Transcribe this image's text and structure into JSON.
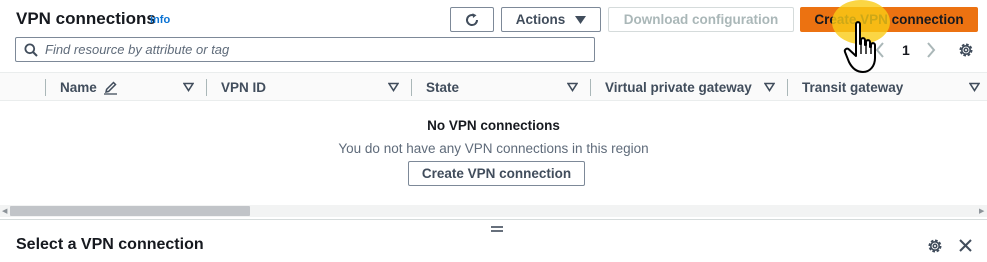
{
  "header": {
    "title": "VPN connections",
    "info_link": "info",
    "actions_label": "Actions",
    "download_label": "Download configuration",
    "create_label": "Create VPN connection"
  },
  "search": {
    "placeholder": "Find resource by attribute or tag",
    "value": ""
  },
  "pagination": {
    "current_page": "1"
  },
  "table": {
    "columns": [
      {
        "label": "Name",
        "editable": true
      },
      {
        "label": "VPN ID"
      },
      {
        "label": "State"
      },
      {
        "label": "Virtual private gateway"
      },
      {
        "label": "Transit gateway"
      }
    ],
    "rows": []
  },
  "empty_state": {
    "title": "No VPN connections",
    "message": "You do not have any VPN connections in this region",
    "button_label": "Create VPN connection"
  },
  "detail_panel": {
    "title": "Select a VPN connection"
  },
  "icons": {
    "refresh": "refresh-icon",
    "caret": "caret-down-icon",
    "search": "search-icon",
    "settings": "gear-icon",
    "close": "close-icon",
    "edit": "pencil-icon",
    "pointer": "hand-pointer-icon"
  },
  "colors": {
    "primary": "#ec7211",
    "link": "#0972d3",
    "disabled_text": "#aab7b8",
    "header_bg": "#fafafa"
  }
}
